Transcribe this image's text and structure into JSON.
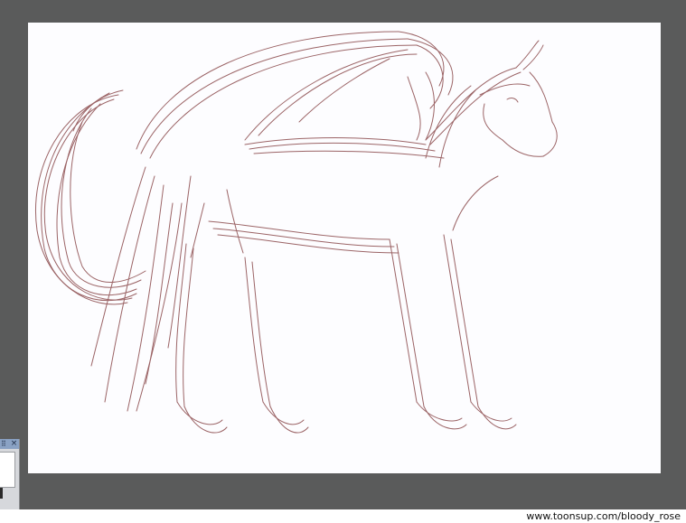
{
  "watermark": {
    "text": "www.toonsup.com/bloody_rose"
  },
  "palette": {
    "grip_icon": "⠿",
    "close_icon": "×"
  },
  "colors": {
    "workspace": "#5a5b5b",
    "canvas": "#fdfdff",
    "stroke": "#8b4a4c"
  }
}
